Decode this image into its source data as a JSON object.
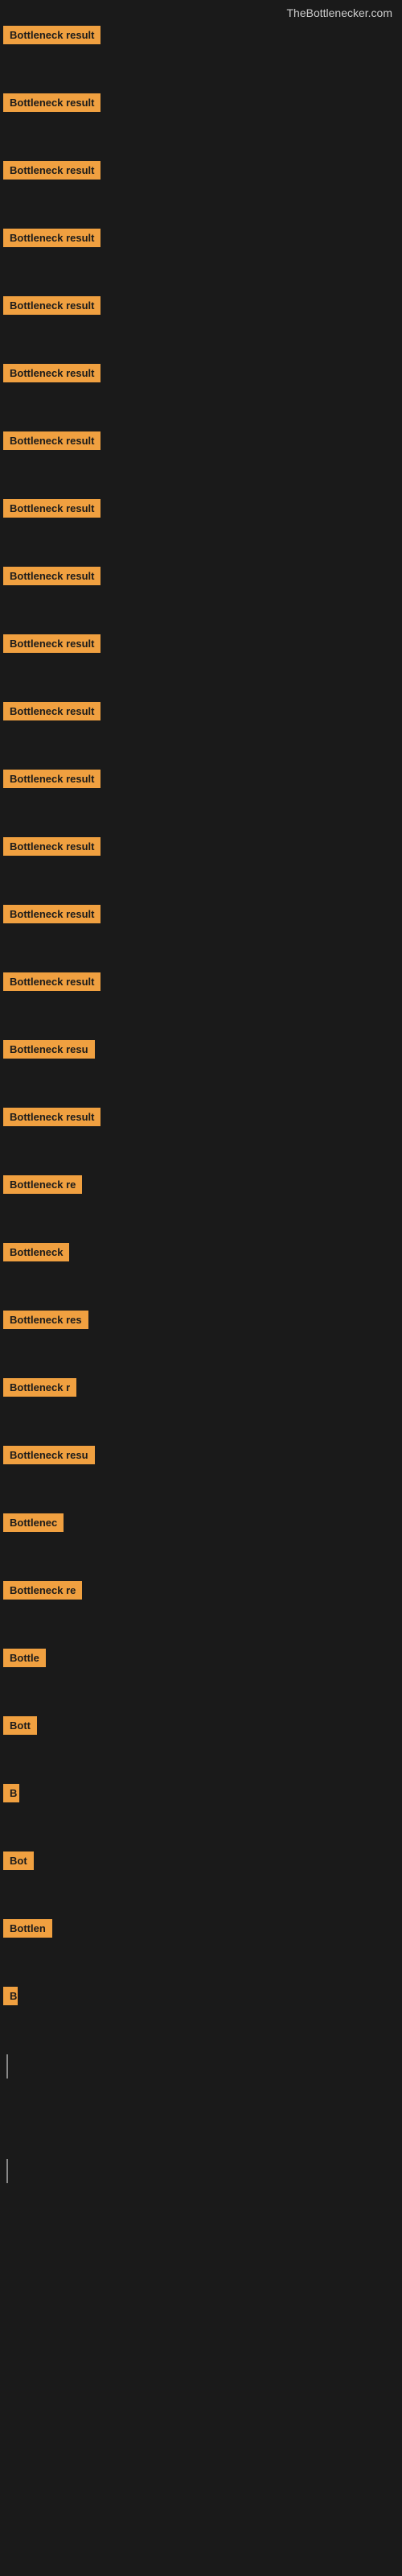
{
  "site": {
    "title": "TheBottlenecker.com"
  },
  "items": [
    {
      "label": "Bottleneck result",
      "width": 155,
      "mb": 28
    },
    {
      "label": "Bottleneck result",
      "width": 155,
      "mb": 28
    },
    {
      "label": "Bottleneck result",
      "width": 155,
      "mb": 28
    },
    {
      "label": "Bottleneck result",
      "width": 155,
      "mb": 28
    },
    {
      "label": "Bottleneck result",
      "width": 155,
      "mb": 28
    },
    {
      "label": "Bottleneck result",
      "width": 155,
      "mb": 28
    },
    {
      "label": "Bottleneck result",
      "width": 155,
      "mb": 28
    },
    {
      "label": "Bottleneck result",
      "width": 155,
      "mb": 28
    },
    {
      "label": "Bottleneck result",
      "width": 155,
      "mb": 28
    },
    {
      "label": "Bottleneck result",
      "width": 155,
      "mb": 28
    },
    {
      "label": "Bottleneck result",
      "width": 155,
      "mb": 28
    },
    {
      "label": "Bottleneck result",
      "width": 140,
      "mb": 28
    },
    {
      "label": "Bottleneck result",
      "width": 155,
      "mb": 28
    },
    {
      "label": "Bottleneck result",
      "width": 155,
      "mb": 28
    },
    {
      "label": "Bottleneck result",
      "width": 155,
      "mb": 28
    },
    {
      "label": "Bottleneck resu",
      "width": 130,
      "mb": 28
    },
    {
      "label": "Bottleneck result",
      "width": 155,
      "mb": 28
    },
    {
      "label": "Bottleneck re",
      "width": 115,
      "mb": 28
    },
    {
      "label": "Bottleneck",
      "width": 90,
      "mb": 28
    },
    {
      "label": "Bottleneck res",
      "width": 120,
      "mb": 28
    },
    {
      "label": "Bottleneck r",
      "width": 100,
      "mb": 28
    },
    {
      "label": "Bottleneck resu",
      "width": 130,
      "mb": 28
    },
    {
      "label": "Bottlenec",
      "width": 85,
      "mb": 28
    },
    {
      "label": "Bottleneck re",
      "width": 115,
      "mb": 28
    },
    {
      "label": "Bottle",
      "width": 65,
      "mb": 28
    },
    {
      "label": "Bott",
      "width": 50,
      "mb": 28
    },
    {
      "label": "B",
      "width": 20,
      "mb": 28
    },
    {
      "label": "Bot",
      "width": 38,
      "mb": 28
    },
    {
      "label": "Bottlen",
      "width": 72,
      "mb": 28
    },
    {
      "label": "B",
      "width": 18,
      "mb": 28
    }
  ],
  "cursors": [
    {
      "height": 30
    },
    {
      "height": 30
    }
  ]
}
